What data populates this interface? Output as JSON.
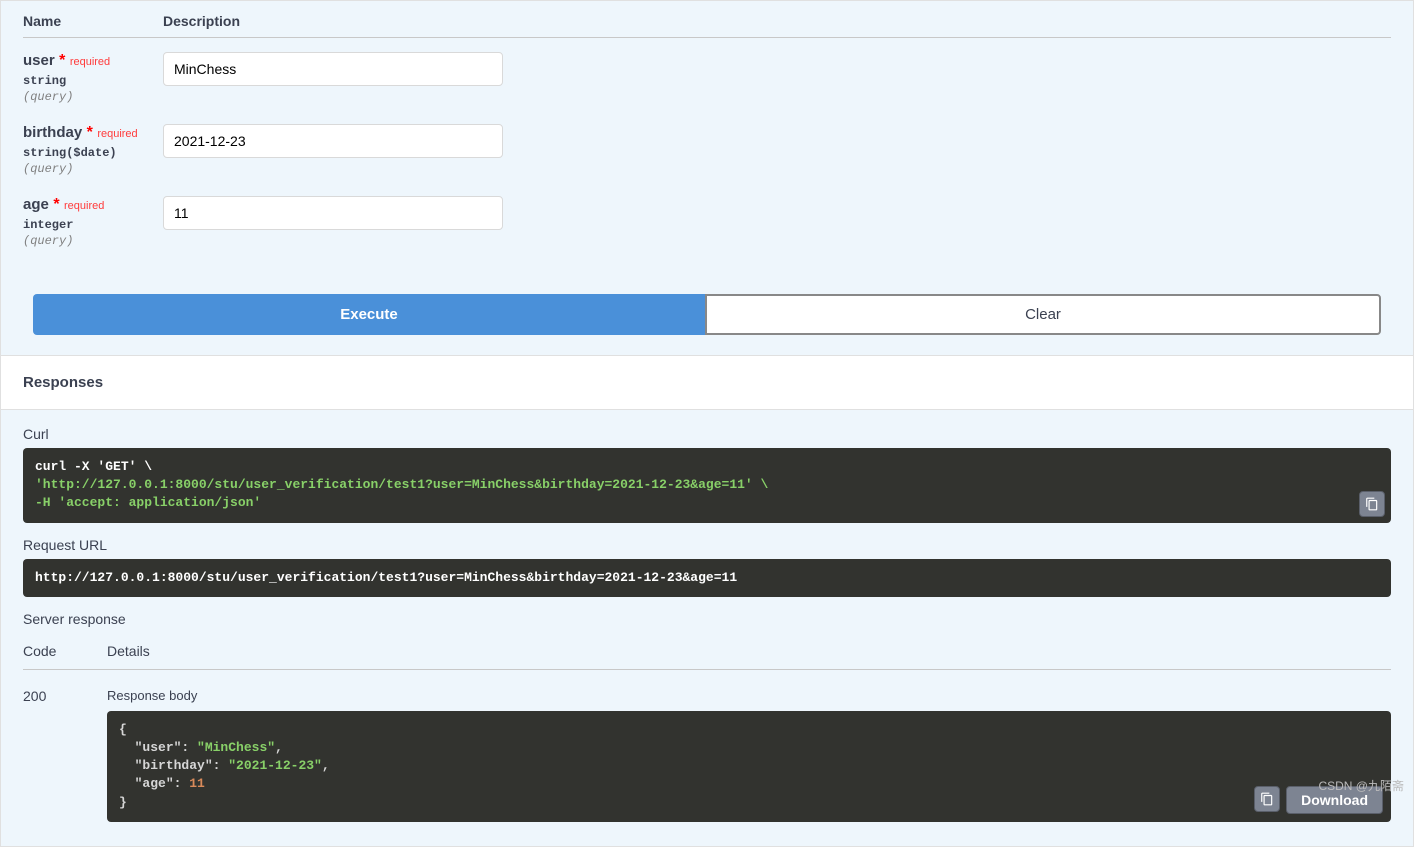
{
  "headers": {
    "name": "Name",
    "description": "Description"
  },
  "params": [
    {
      "key": "user",
      "name": "user",
      "required": "required",
      "type": "string",
      "in": "(query)",
      "value": "MinChess"
    },
    {
      "key": "birthday",
      "name": "birthday",
      "required": "required",
      "type": "string($date)",
      "in": "(query)",
      "value": "2021-12-23"
    },
    {
      "key": "age",
      "name": "age",
      "required": "required",
      "type": "integer",
      "in": "(query)",
      "value": "11"
    }
  ],
  "buttons": {
    "execute": "Execute",
    "clear": "Clear",
    "download": "Download"
  },
  "responses": {
    "title": "Responses",
    "curl_label": "Curl",
    "curl_line1": "curl -X 'GET' \\",
    "curl_line2": "  'http://127.0.0.1:8000/stu/user_verification/test1?user=MinChess&birthday=2021-12-23&age=11' \\",
    "curl_line3": "  -H 'accept: application/json'",
    "request_url_label": "Request URL",
    "request_url": "http://127.0.0.1:8000/stu/user_verification/test1?user=MinChess&birthday=2021-12-23&age=11",
    "server_response_label": "Server response",
    "code_header": "Code",
    "details_header": "Details",
    "code": "200",
    "response_body_label": "Response body",
    "body": {
      "open": "{",
      "user_key": "\"user\"",
      "user_val": "\"MinChess\"",
      "birthday_key": "\"birthday\"",
      "birthday_val": "\"2021-12-23\"",
      "age_key": "\"age\"",
      "age_val": "11",
      "close": "}"
    }
  },
  "watermark": "CSDN @九陌斋"
}
